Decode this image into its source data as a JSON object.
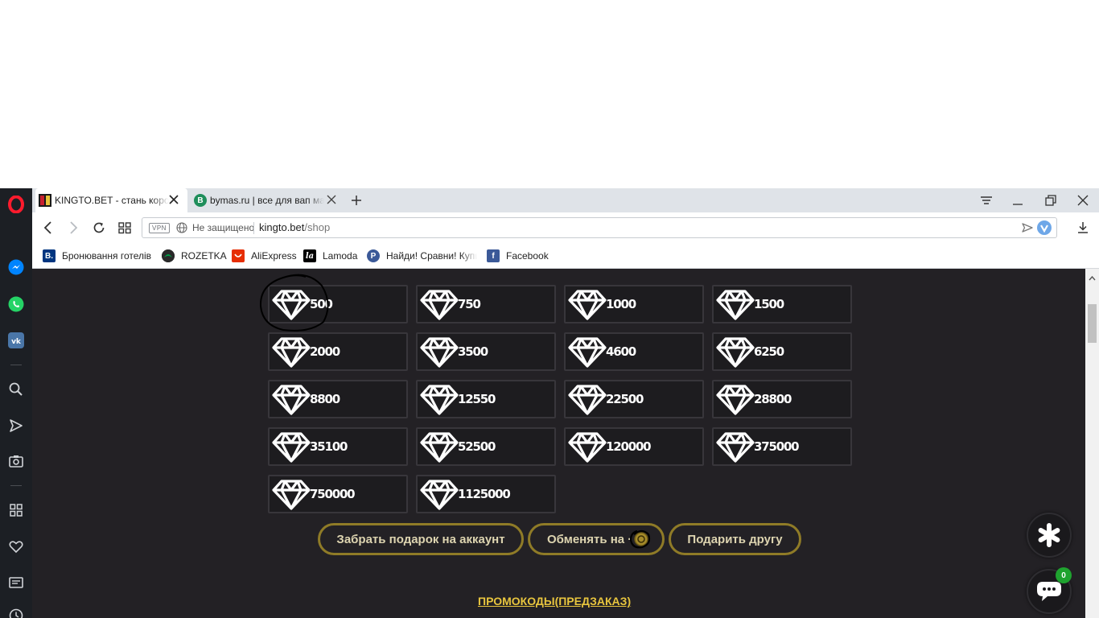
{
  "browser": {
    "tabs": [
      {
        "title": "KINGTO.BET - стань король",
        "active": true
      },
      {
        "title": "bymas.ru | все для вап мастера",
        "active": false
      }
    ],
    "address": {
      "vpn_label": "VPN",
      "security_label": "Не защищено",
      "url_host": "kingto.bet",
      "url_path": "/shop"
    },
    "bookmarks": [
      {
        "label": "Бронювання готелів",
        "icon": "booking-icon",
        "color": "#003580",
        "glyph": "B."
      },
      {
        "label": "ROZETKA",
        "icon": "rozetka-icon",
        "color": "#00a046",
        "glyph": ""
      },
      {
        "label": "AliExpress",
        "icon": "aliexpress-icon",
        "color": "#e62e04",
        "glyph": ""
      },
      {
        "label": "Lamoda",
        "icon": "lamoda-icon",
        "color": "#000000",
        "glyph": "la"
      },
      {
        "label": "Найди! Сравни! Купи!",
        "icon": "price-compare-icon",
        "color": "#3b5998",
        "glyph": "P"
      },
      {
        "label": "Facebook",
        "icon": "facebook-icon",
        "color": "#3b5998",
        "glyph": "f"
      }
    ]
  },
  "shop": {
    "gems": [
      "500",
      "750",
      "1000",
      "1500",
      "2000",
      "3500",
      "4600",
      "6250",
      "8800",
      "12550",
      "22500",
      "28800",
      "35100",
      "52500",
      "120000",
      "375000",
      "750000",
      "1125000"
    ],
    "actions": {
      "claim": "Забрать подарок на аккаунт",
      "exchange": "Обменять на ·",
      "gift": "Подарить другу"
    },
    "promo_link": "ПРОМОКОДЫ(ПРЕДЗАКАЗ)",
    "chat_badge": "0"
  },
  "colors": {
    "page_bg": "#232125",
    "card_border": "#38363b",
    "button_border": "#8f7b27",
    "promo": "#e8c53e",
    "badge": "#1fa32f"
  }
}
